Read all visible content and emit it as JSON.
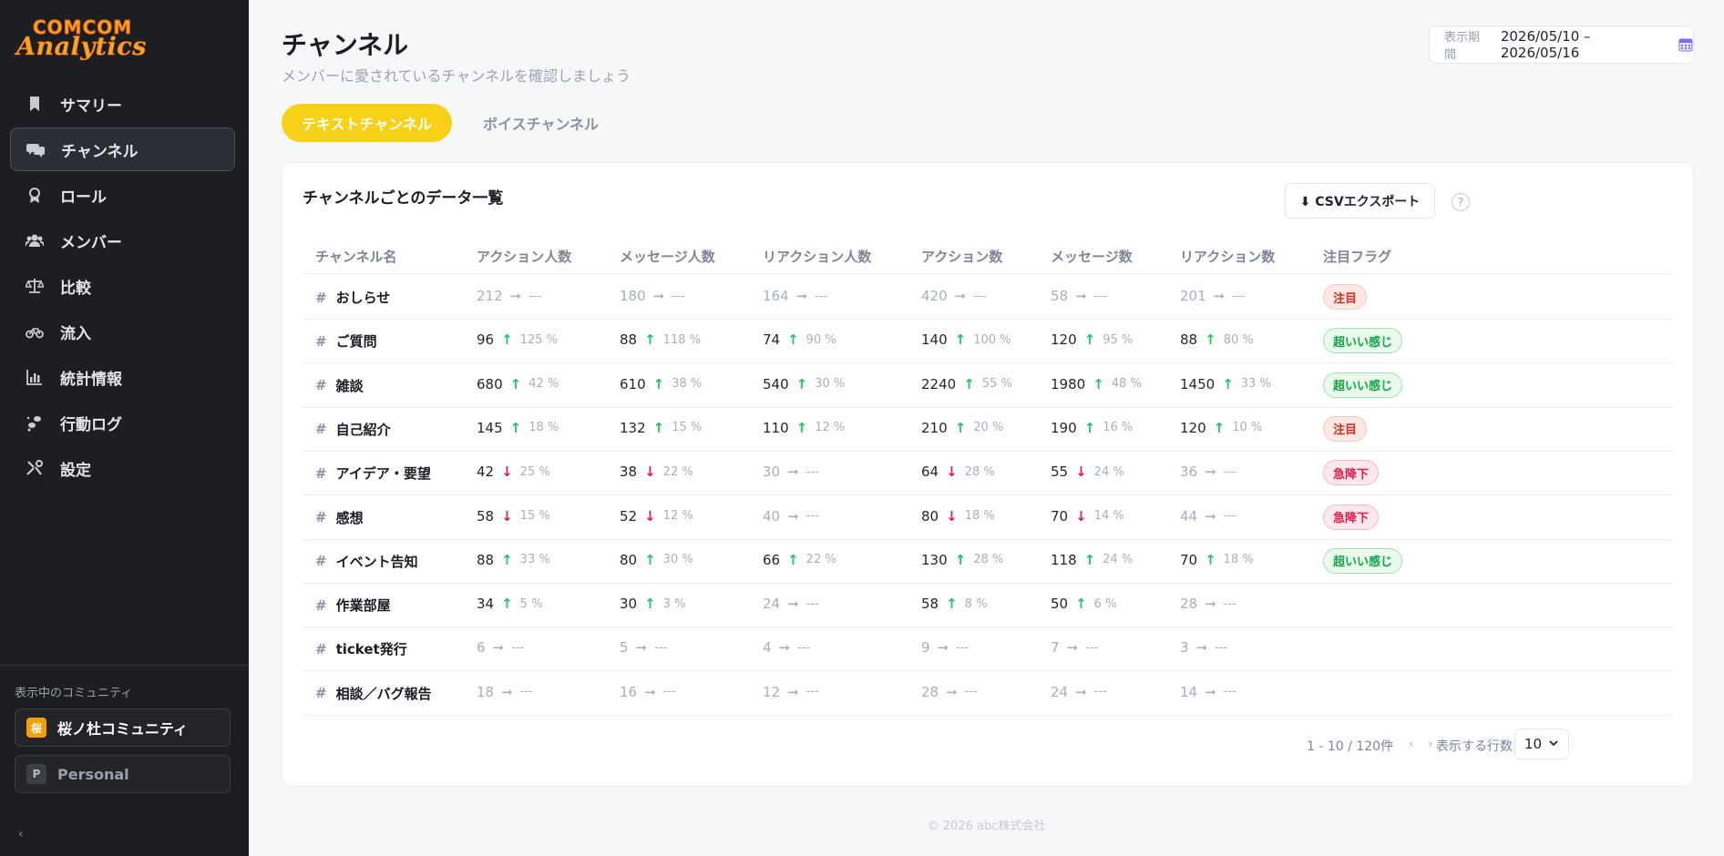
{
  "logo": {
    "line1": "COMCOM",
    "line2": "Analytics"
  },
  "sidebar": {
    "items": [
      {
        "label": "サマリー",
        "icon": "bookmark-icon",
        "active": false
      },
      {
        "label": "チャンネル",
        "icon": "chat-bubbles-icon",
        "active": true
      },
      {
        "label": "ロール",
        "icon": "award-icon",
        "active": false
      },
      {
        "label": "メンバー",
        "icon": "users-icon",
        "active": false
      },
      {
        "label": "比較",
        "icon": "scale-icon",
        "active": false
      },
      {
        "label": "流入",
        "icon": "bicycle-icon",
        "active": false
      },
      {
        "label": "統計情報",
        "icon": "bar-chart-icon",
        "active": false
      },
      {
        "label": "行動ログ",
        "icon": "footprints-icon",
        "active": false
      },
      {
        "label": "設定",
        "icon": "tools-icon",
        "active": false
      }
    ],
    "community_label": "表示中のコミュニティ",
    "communities": [
      {
        "badge": "桜",
        "name": "桜ノ杜コミュニティ"
      },
      {
        "badge": "P",
        "name": "Personal"
      }
    ],
    "collapse": "‹"
  },
  "header": {
    "title": "チャンネル",
    "subtitle": "メンバーに愛されているチャンネルを確認しましょう",
    "period_label": "表示期間",
    "period_value": "2026/05/10 – 2026/05/16"
  },
  "tabs": [
    {
      "label": "テキストチャンネル",
      "active": true
    },
    {
      "label": "ボイスチャンネル",
      "active": false
    }
  ],
  "table": {
    "title": "チャンネルごとのデータ一覧",
    "csv_button": "⬇ CSVエクスポート",
    "help": "?",
    "columns": [
      "チャンネル名",
      "アクション人数",
      "メッセージ人数",
      "リアクション人数",
      "アクション数",
      "メッセージ数",
      "リアクション数",
      "注目フラグ"
    ],
    "rows": [
      {
        "name": "おしらせ",
        "cells": [
          [
            "212",
            "flat",
            "---"
          ],
          [
            "180",
            "flat",
            "---"
          ],
          [
            "164",
            "flat",
            "---"
          ],
          [
            "420",
            "flat",
            "---"
          ],
          [
            "58",
            "flat",
            "---"
          ],
          [
            "201",
            "flat",
            "---"
          ]
        ],
        "flag": "注目",
        "flag_type": "hot"
      },
      {
        "name": "ご質問",
        "cells": [
          [
            "96",
            "up",
            "125 %"
          ],
          [
            "88",
            "up",
            "118 %"
          ],
          [
            "74",
            "up",
            "90 %"
          ],
          [
            "140",
            "up",
            "100 %"
          ],
          [
            "120",
            "up",
            "95 %"
          ],
          [
            "88",
            "up",
            "80 %"
          ]
        ],
        "flag": "超いい感じ",
        "flag_type": "good"
      },
      {
        "name": "雑談",
        "cells": [
          [
            "680",
            "up",
            "42 %"
          ],
          [
            "610",
            "up",
            "38 %"
          ],
          [
            "540",
            "up",
            "30 %"
          ],
          [
            "2240",
            "up",
            "55 %"
          ],
          [
            "1980",
            "up",
            "48 %"
          ],
          [
            "1450",
            "up",
            "33 %"
          ]
        ],
        "flag": "超いい感じ",
        "flag_type": "good"
      },
      {
        "name": "自己紹介",
        "cells": [
          [
            "145",
            "up",
            "18 %"
          ],
          [
            "132",
            "up",
            "15 %"
          ],
          [
            "110",
            "up",
            "12 %"
          ],
          [
            "210",
            "up",
            "20 %"
          ],
          [
            "190",
            "up",
            "16 %"
          ],
          [
            "120",
            "up",
            "10 %"
          ]
        ],
        "flag": "注目",
        "flag_type": "hot"
      },
      {
        "name": "アイデア・要望",
        "cells": [
          [
            "42",
            "down",
            "25 %"
          ],
          [
            "38",
            "down",
            "22 %"
          ],
          [
            "30",
            "flat",
            "---"
          ],
          [
            "64",
            "down",
            "28 %"
          ],
          [
            "55",
            "down",
            "24 %"
          ],
          [
            "36",
            "flat",
            "---"
          ]
        ],
        "flag": "急降下",
        "flag_type": "drop"
      },
      {
        "name": "感想",
        "cells": [
          [
            "58",
            "down",
            "15 %"
          ],
          [
            "52",
            "down",
            "12 %"
          ],
          [
            "40",
            "flat",
            "---"
          ],
          [
            "80",
            "down",
            "18 %"
          ],
          [
            "70",
            "down",
            "14 %"
          ],
          [
            "44",
            "flat",
            "---"
          ]
        ],
        "flag": "急降下",
        "flag_type": "drop"
      },
      {
        "name": "イベント告知",
        "cells": [
          [
            "88",
            "up",
            "33 %"
          ],
          [
            "80",
            "up",
            "30 %"
          ],
          [
            "66",
            "up",
            "22 %"
          ],
          [
            "130",
            "up",
            "28 %"
          ],
          [
            "118",
            "up",
            "24 %"
          ],
          [
            "70",
            "up",
            "18 %"
          ]
        ],
        "flag": "超いい感じ",
        "flag_type": "good"
      },
      {
        "name": "作業部屋",
        "cells": [
          [
            "34",
            "up",
            "5 %"
          ],
          [
            "30",
            "up",
            "3 %"
          ],
          [
            "24",
            "flat",
            "---"
          ],
          [
            "58",
            "up",
            "8 %"
          ],
          [
            "50",
            "up",
            "6 %"
          ],
          [
            "28",
            "flat",
            "---"
          ]
        ],
        "flag": "",
        "flag_type": ""
      },
      {
        "name": "ticket発行",
        "cells": [
          [
            "6",
            "flat",
            "---"
          ],
          [
            "5",
            "flat",
            "---"
          ],
          [
            "4",
            "flat",
            "---"
          ],
          [
            "9",
            "flat",
            "---"
          ],
          [
            "7",
            "flat",
            "---"
          ],
          [
            "3",
            "flat",
            "---"
          ]
        ],
        "flag": "",
        "flag_type": ""
      },
      {
        "name": "相談／バグ報告",
        "cells": [
          [
            "18",
            "flat",
            "---"
          ],
          [
            "16",
            "flat",
            "---"
          ],
          [
            "12",
            "flat",
            "---"
          ],
          [
            "28",
            "flat",
            "---"
          ],
          [
            "24",
            "flat",
            "---"
          ],
          [
            "14",
            "flat",
            "---"
          ]
        ],
        "flag": "",
        "flag_type": ""
      }
    ]
  },
  "pagination": {
    "range": "1 - 10 / 120件",
    "nav": "« ‹ › »",
    "rows_label": "表示する行数",
    "rows_value": "10"
  },
  "footer": "© 2026 abc株式会社",
  "colors": {
    "accent": "#f7d117",
    "up": "#22c55e",
    "down": "#e11d48",
    "sidebar": "#1c1e22"
  }
}
